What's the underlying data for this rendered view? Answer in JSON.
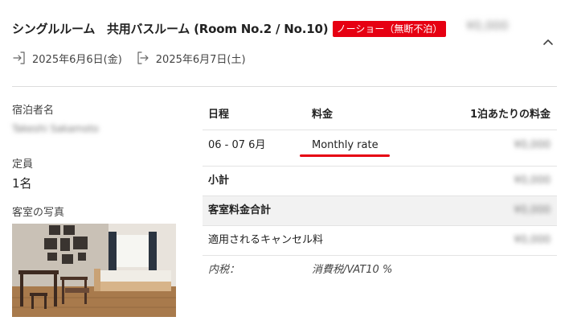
{
  "room": {
    "title": "シングルルーム　共用バスルーム (Room No.2 / No.10)",
    "status_badge": "ノーショー（無断不泊）",
    "total_price": "¥0,000",
    "checkin_date": "2025年6月6日(金)",
    "checkout_date": "2025年6月7日(土)"
  },
  "guest": {
    "name_label": "宿泊者名",
    "name_value": "Takeshi Sakamoto",
    "capacity_label": "定員",
    "capacity_value": "1名",
    "photo_label": "客室の写真"
  },
  "table": {
    "headers": {
      "date": "日程",
      "fee": "料金",
      "per_night": "1泊あたりの料金"
    },
    "rows": {
      "stay": {
        "date": "06 - 07 6月",
        "rate": "Monthly rate",
        "per_night": "¥0,000"
      },
      "subtotal": {
        "label": "小計",
        "value": "¥0,000"
      },
      "room_total": {
        "label": "客室料金合計",
        "value": "¥0,000"
      },
      "cancel_fee": {
        "label": "適用されるキャンセル料",
        "value": "¥0,000"
      },
      "tax": {
        "label": "内税：",
        "value": "消費税/VAT10 %"
      }
    }
  },
  "colors": {
    "accent": "#e60012",
    "divider": "#e3e3e3",
    "shaded_row": "#f2f2f2"
  },
  "icons": [
    "checkin-icon",
    "checkout-icon",
    "chevron-up-icon"
  ]
}
